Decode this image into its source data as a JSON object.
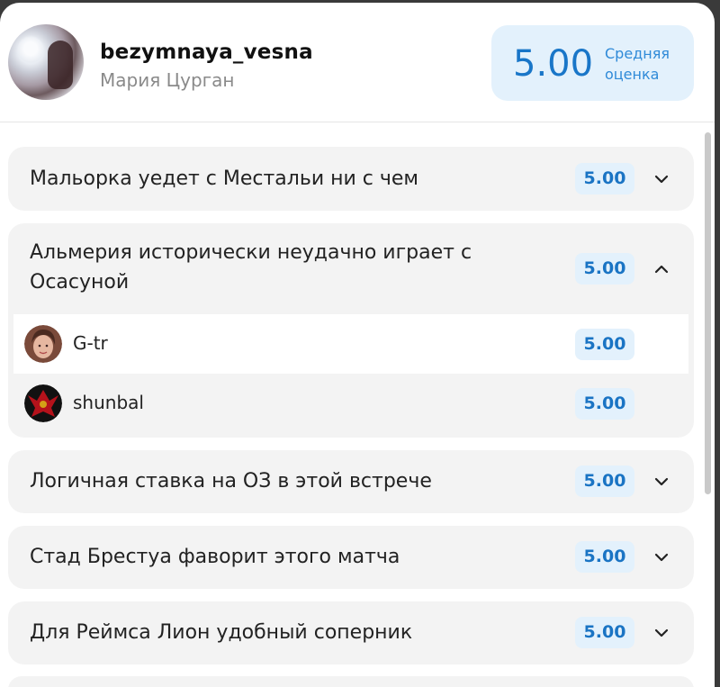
{
  "profile": {
    "username": "bezymnaya_vesna",
    "real_name": "Мария Цурган",
    "average_score": "5.00",
    "average_caption": "Средняя оценка"
  },
  "predictions": [
    {
      "title": "Мальорка уедет с Местальи ни с чем",
      "score": "5.00",
      "expanded": false
    },
    {
      "title": "Альмерия исторически неудачно играет с Осасуной",
      "score": "5.00",
      "expanded": true,
      "ratings": [
        {
          "user": "G-tr",
          "score": "5.00"
        },
        {
          "user": "shunbal",
          "score": "5.00"
        }
      ]
    },
    {
      "title": "Логичная ставка на ОЗ в этой встрече",
      "score": "5.00",
      "expanded": false
    },
    {
      "title": "Стад Брестуа фаворит этого матча",
      "score": "5.00",
      "expanded": false
    },
    {
      "title": "Для Реймса Лион удобный соперник",
      "score": "5.00",
      "expanded": false
    }
  ],
  "icons": {
    "collapsed": "chevron-down-icon",
    "expanded": "chevron-up-icon"
  }
}
